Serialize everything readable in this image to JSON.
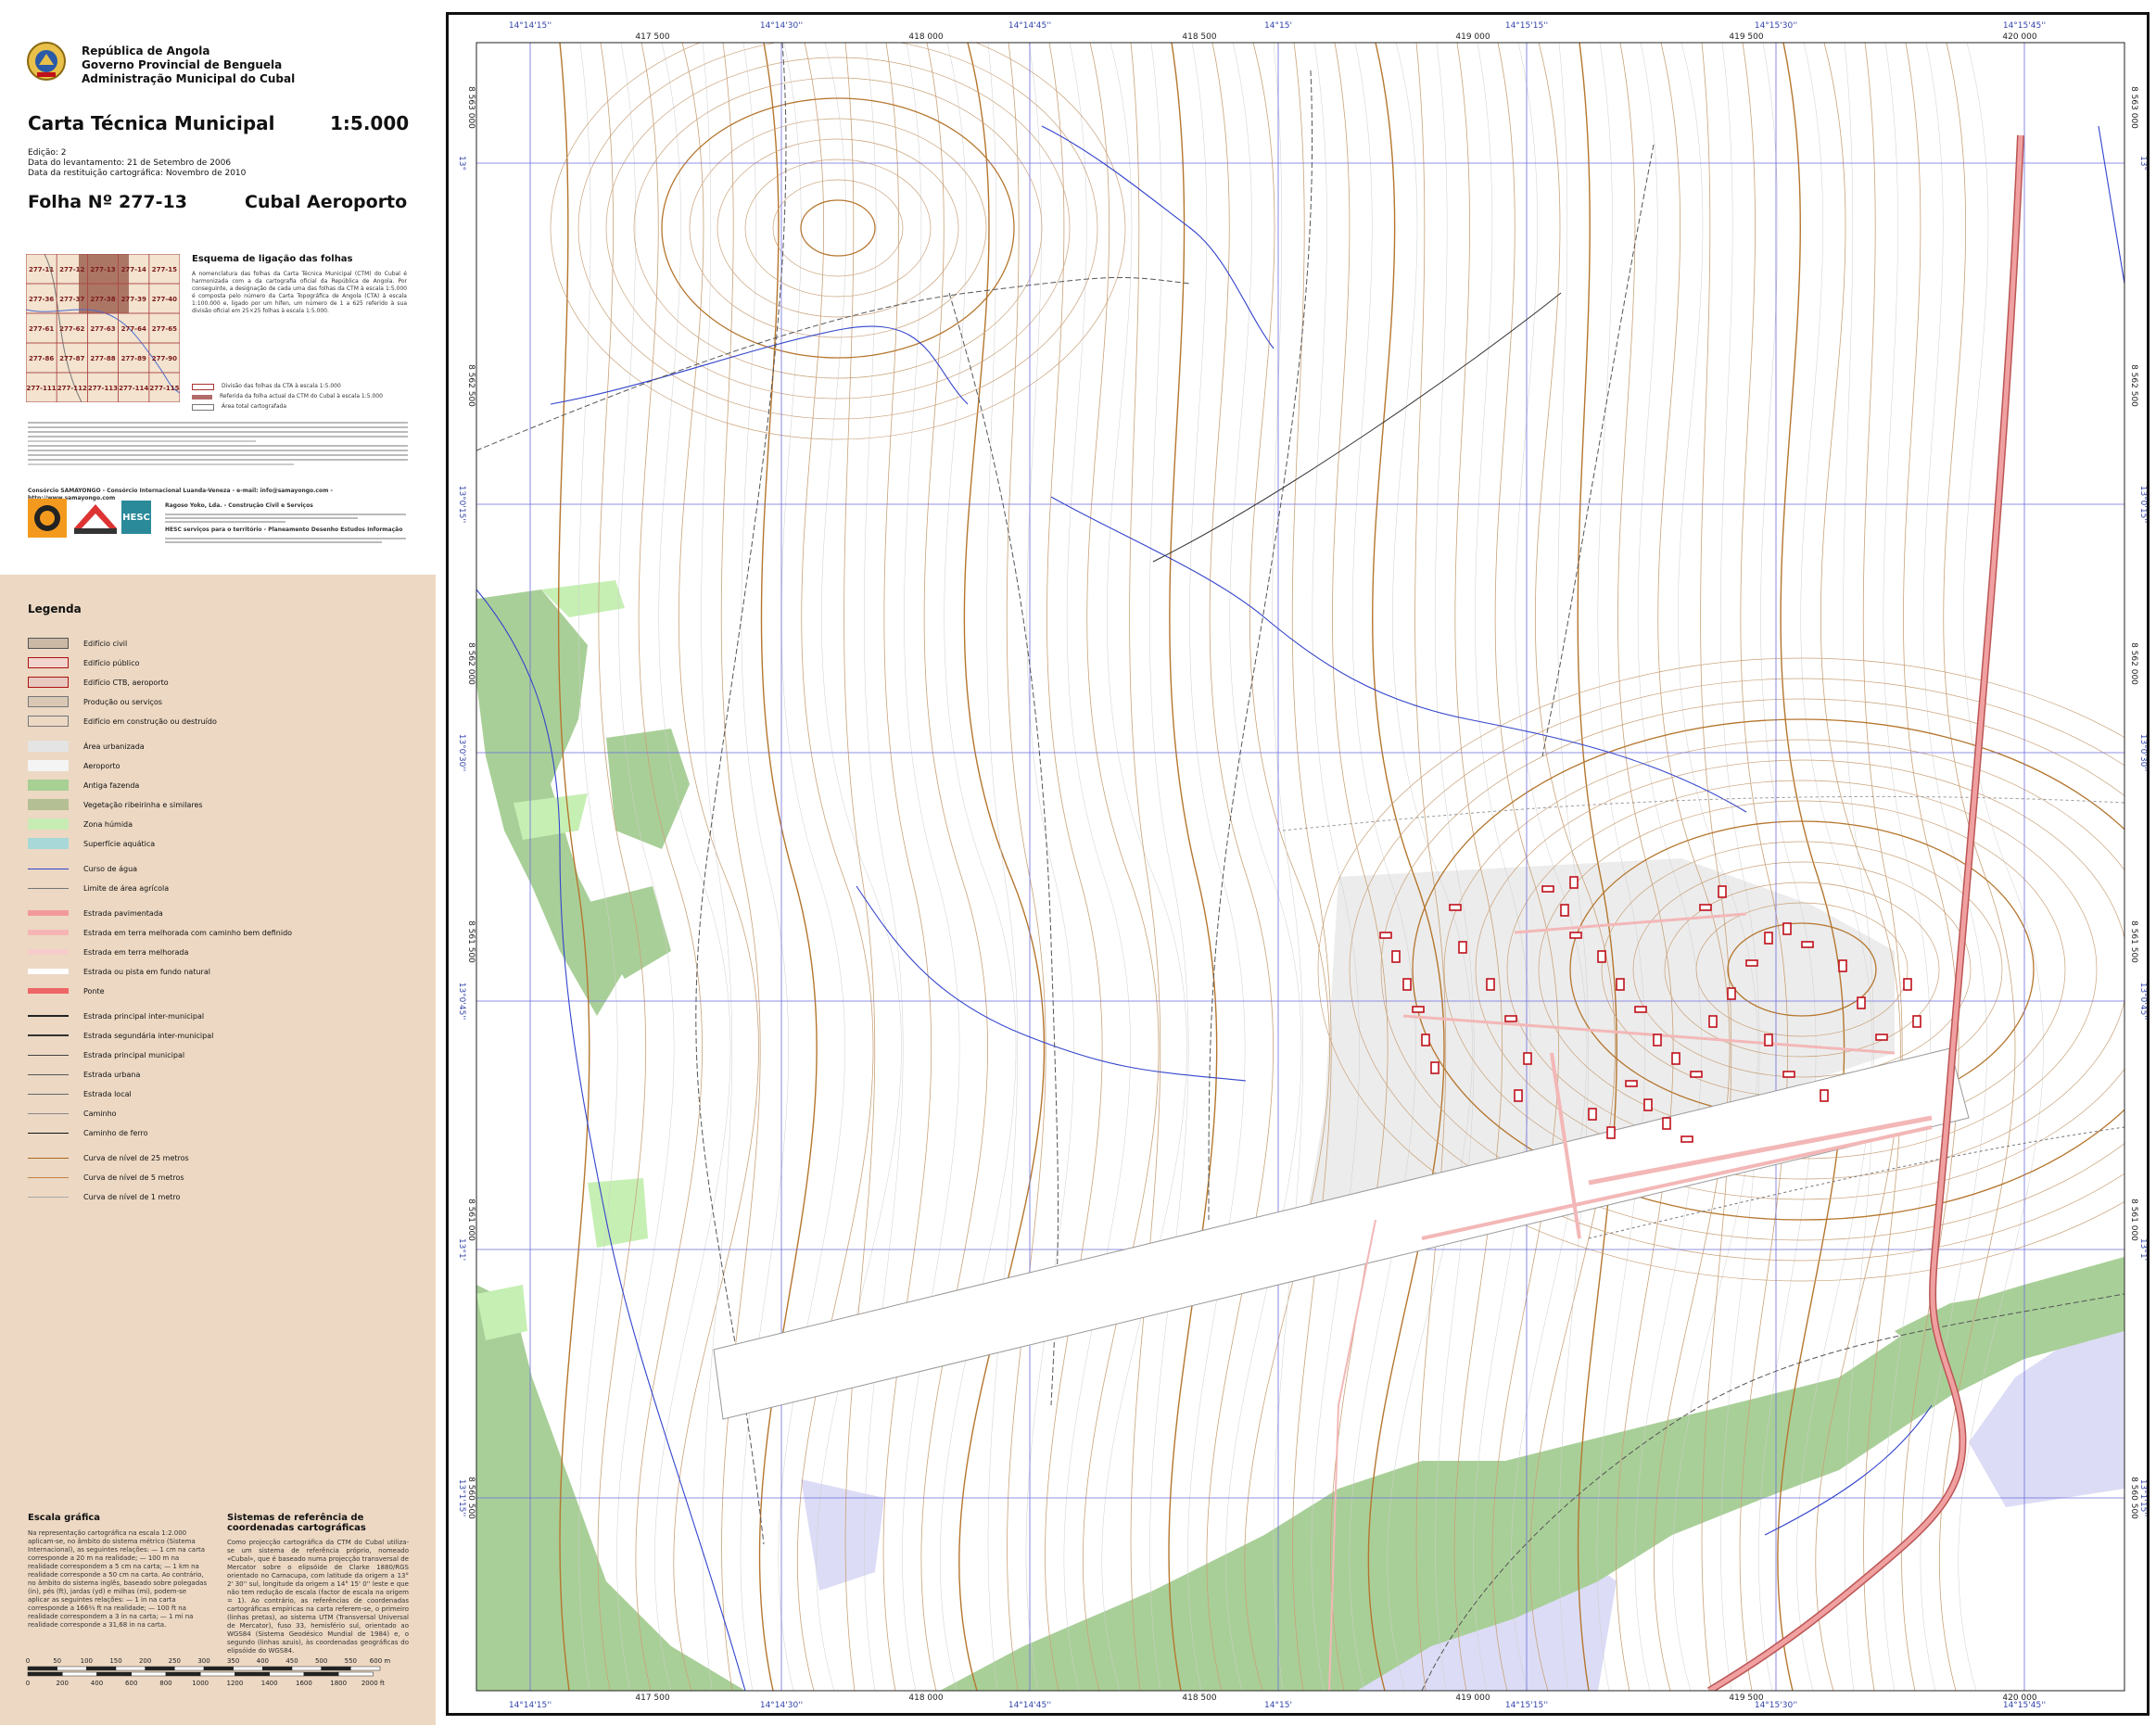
{
  "header": {
    "line1": "República de Angola",
    "line2": "Governo Provincial de Benguela",
    "line3": "Administração Municipal do Cubal",
    "title": "Carta Técnica Municipal",
    "scale": "1:5.000",
    "edition": "Edição: 2",
    "survey_date": "Data do levantamento: 21 de Setembro de 2006",
    "restitution_date": "Data da restituição cartográfica: Novembro de 2010",
    "sheet_label": "Folha Nº  277-13",
    "sheet_name": "Cubal Aeroporto"
  },
  "index_map": {
    "heading": "Esquema de ligação das folhas",
    "cells": [
      "277-11",
      "277-12",
      "277-13",
      "277-14",
      "277-15",
      "277-36",
      "277-37",
      "277-38",
      "277-39",
      "277-40",
      "277-61",
      "277-62",
      "277-63",
      "277-64",
      "277-65",
      "277-86",
      "277-87",
      "277-88",
      "277-89",
      "277-90",
      "277-111",
      "277-112",
      "277-113",
      "277-114",
      "277-115"
    ],
    "body": "A nomenclatura das folhas da Carta Técnica Municipal (CTM) do Cubal é harmonizada com a da cartografia oficial da República de Angola. Por conseguinte, a designação de cada uma das folhas da CTM à escala 1:5.000 é composta pelo número da Carta Topográfica de Angola (CTA) à escala 1:100.000 e, ligado por um hífen, um número de 1 a 625 referido à sua divisão oficial em 25×25 folhas à escala 1:5.000.",
    "legend1": "Divisão das folhas da CTA à escala 1:5.000",
    "legend2": "Referida da folha actual da CTM do Cubal à escala 1:5.000",
    "legend3": "Área total cartografada"
  },
  "credits": {
    "consortium": "Consórcio SAMAYONGO - Consórcio Internacional Luanda-Veneza - e-mail: info@samayongo.com - http://www.samayongo.com",
    "company1": "Ragoso Yoko, Lda. - Construção Civil e Serviços",
    "company2": "HESC serviços para o território - Planeamento Desenho Estudos Informação",
    "logo_text": "HESC"
  },
  "legend": {
    "title": "Legenda",
    "items": [
      {
        "label": "Edifício civil",
        "kind": "fill",
        "color": "#cbb9a6",
        "border": "#555555"
      },
      {
        "label": "Edifício público",
        "kind": "fill",
        "color": "#f2d4cf",
        "border": "#aa1111"
      },
      {
        "label": "Edifício CTB, aeroporto",
        "kind": "fill",
        "color": "#e8c9c0",
        "border": "#aa1111"
      },
      {
        "label": "Produção ou serviços",
        "kind": "fill",
        "color": "#d9c8b6",
        "border": "#777777"
      },
      {
        "label": "Edifício em construção ou destruído",
        "kind": "fill",
        "color": "#ecd8c3",
        "border": "#777777"
      },
      {
        "label": "Área urbanizada",
        "kind": "fill",
        "color": "#e4e4e4",
        "border": "#e4e4e4"
      },
      {
        "label": "Aeroporto",
        "kind": "fill",
        "color": "#f4f4f4",
        "border": "#f4f4f4"
      },
      {
        "label": "Antiga fazenda",
        "kind": "fill",
        "color": "#a8cf94",
        "border": "#a8cf94"
      },
      {
        "label": "Vegetação ribeirinha e similares",
        "kind": "fill",
        "color": "#b4bf94",
        "border": "#b4bf94"
      },
      {
        "label": "Zona húmida",
        "kind": "fill",
        "color": "#c7ecb4",
        "border": "#c7ecb4"
      },
      {
        "label": "Superfície aquática",
        "kind": "fill",
        "color": "#a8d8d8",
        "border": "#a8d8d8"
      },
      {
        "label": "Curso de água",
        "kind": "line",
        "color": "#3344cc",
        "width": 1
      },
      {
        "label": "Limite de área agrícola",
        "kind": "line",
        "color": "#777777",
        "width": 1
      },
      {
        "label": "Estrada pavimentada",
        "kind": "line",
        "color": "#f29a9a",
        "width": 6
      },
      {
        "label": "Estrada em terra melhorada com caminho bem definido",
        "kind": "line",
        "color": "#f6b5b5",
        "width": 6
      },
      {
        "label": "Estrada em terra melhorada",
        "kind": "line",
        "color": "#f8cccc",
        "width": 6
      },
      {
        "label": "Estrada ou pista em fundo natural",
        "kind": "line",
        "color": "#ffffff",
        "width": 6
      },
      {
        "label": "Ponte",
        "kind": "line",
        "color": "#ee6666",
        "width": 6
      },
      {
        "label": "Estrada principal inter-municipal",
        "kind": "line",
        "color": "#222222",
        "width": 2
      },
      {
        "label": "Estrada segundária inter-municipal",
        "kind": "line",
        "color": "#333333",
        "width": 2
      },
      {
        "label": "Estrada principal municipal",
        "kind": "line",
        "color": "#444444",
        "width": 1.5
      },
      {
        "label": "Estrada urbana",
        "kind": "line",
        "color": "#555555",
        "width": 1
      },
      {
        "label": "Estrada local",
        "kind": "line",
        "color": "#666666",
        "width": 1
      },
      {
        "label": "Caminho",
        "kind": "line",
        "color": "#888888",
        "width": 1
      },
      {
        "label": "Caminho de ferro",
        "kind": "line",
        "color": "#111111",
        "width": 1.5
      },
      {
        "label": "Curva de nível de 25 metros",
        "kind": "line",
        "color": "#b0661c",
        "width": 1.5
      },
      {
        "label": "Curva de nível de 5 metros",
        "kind": "line",
        "color": "#c08040",
        "width": 1
      },
      {
        "label": "Curva de nível de 1 metro",
        "kind": "line",
        "color": "#aaaaaa",
        "width": 0.5
      }
    ]
  },
  "scale_section": {
    "title": "Escala gráfica",
    "text": "Na representação cartográfica na escala 1:2.000 aplicam-se, no âmbito do sistema métrico (Sistema Internacional), as seguintes relações: — 1 cm na carta corresponde a 20 m na realidade; — 100 m na realidade correspondem a 5 cm na carta; — 1 km na realidade corresponde a 50 cm na carta. Ao contrário, no âmbito do sistema inglês, baseado sobre polegadas (in), pés (ft), jardas (yd) e milhas (mi), podem-se aplicar as seguintes relações: — 1 in na carta corresponde a 166⅔ ft na realidade; — 100 ft na realidade correspondem a 3 in na carta; — 1 mi na realidade corresponde a 31,68 in na carta.",
    "metres": [
      "0",
      "50",
      "100",
      "150",
      "200",
      "250",
      "300",
      "350",
      "400",
      "450",
      "500",
      "550",
      "600 m"
    ],
    "feet": [
      "0",
      "200",
      "400",
      "600",
      "800",
      "1000",
      "1200",
      "1400",
      "1600",
      "1800",
      "2000 ft"
    ]
  },
  "crs_section": {
    "title": "Sistemas de referência de coordenadas cartográficas",
    "text": "Como projecção cartográfica da CTM do Cubal utiliza-se um sistema de referência próprio, nomeado «Cubal», que é baseado numa projecção transversal de Mercator sobre o elipsóide de Clarke 1880/RGS orientado no Camacupa, com latitude da origem a 13° 2' 30'' sul, longitude da origem a 14° 15' 0'' leste e que não tem redução de escala (factor de escala na origem = 1). Ao contrário, as referências de coordenadas cartográficas empíricas na carta referem-se, o primeiro (linhas pretas), ao sistema UTM (Transversal Universal de Mercator), fuso 33, hemisfério sul, orientado ao WGS84 (Sistema Geodésico Mundial de 1984) e, o segundo (linhas azuis), às coordenadas geográficas do elipsóide do WGS84."
  },
  "map": {
    "top_dms": [
      "14°14'15''",
      "14°14'30''",
      "14°14'45''",
      "14°15'",
      "14°15'15''",
      "14°15'30''",
      "14°15'45''"
    ],
    "top_utm": [
      "417 500",
      "418 000",
      "418 500",
      "419 000",
      "419 500",
      "420 000"
    ],
    "bottom_dms": [
      "14°14'15''",
      "14°14'30''",
      "14°14'45''",
      "14°15'",
      "14°15'15''",
      "14°15'30''",
      "14°15'45''"
    ],
    "bottom_utm": [
      "417 500",
      "418 000",
      "418 500",
      "419 000",
      "419 500",
      "420 000"
    ],
    "left_utm": [
      "8 563 000",
      "8 562 500",
      "8 562 000",
      "8 561 500",
      "8 561 000",
      "8 560 500"
    ],
    "left_dms": [
      "13°",
      "13°0'15''",
      "13°0'30''",
      "13°0'45''",
      "13°1'",
      "13°1'15''"
    ],
    "colors": {
      "contour_major": "#b5762e",
      "contour_minor": "#c9a27a",
      "contour_fine": "#cfcfcf",
      "grid_blue": "#6c6cdc",
      "grid_black": "#555555",
      "river": "#3344cc",
      "vegetation": "#a9cf98",
      "wetland": "#c6efb4",
      "water": "#dcdcf6",
      "urban": "#ececec",
      "runway": "#ffffff",
      "road_paved": "#f0a0a0",
      "building": "#c0101a"
    }
  }
}
